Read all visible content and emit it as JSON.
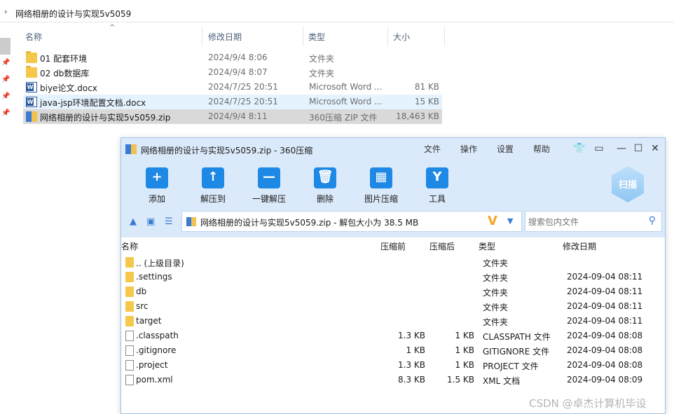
{
  "explorer": {
    "breadcrumb": "网络相册的设计与实现5v5059",
    "columns": {
      "name": "名称",
      "date": "修改日期",
      "type": "类型",
      "size": "大小"
    },
    "files": [
      {
        "name": "01 配套环境",
        "date": "2024/9/4 8:06",
        "type": "文件夹",
        "size": "",
        "icon": "folder-icon"
      },
      {
        "name": "02 db数据库",
        "date": "2024/9/4 8:07",
        "type": "文件夹",
        "size": "",
        "icon": "folder-icon"
      },
      {
        "name": "biye论文.docx",
        "date": "2024/7/25 20:51",
        "type": "Microsoft Word ...",
        "size": "81 KB",
        "icon": "word-doc-icon"
      },
      {
        "name": "java-jsp环境配置文档.docx",
        "date": "2024/7/25 20:51",
        "type": "Microsoft Word ...",
        "size": "15 KB",
        "icon": "word-doc-icon"
      },
      {
        "name": "网络相册的设计与实现5v5059.zip",
        "date": "2024/9/4 8:11",
        "type": "360压缩 ZIP 文件",
        "size": "18,463 KB",
        "icon": "zip-archive-icon"
      }
    ]
  },
  "archive_window": {
    "title": "网络相册的设计与实现5v5059.zip - 360压缩",
    "menu": [
      "文件",
      "操作",
      "设置",
      "帮助"
    ],
    "tools": [
      {
        "label": "添加",
        "icon": "add-icon",
        "glyph": "+"
      },
      {
        "label": "解压到",
        "icon": "extract-to-icon",
        "glyph": "↑"
      },
      {
        "label": "一键解压",
        "icon": "one-click-extract-icon",
        "glyph": "—"
      },
      {
        "label": "删除",
        "icon": "delete-icon",
        "glyph": "🗑"
      },
      {
        "label": "图片压缩",
        "icon": "image-compress-icon",
        "glyph": "▦"
      },
      {
        "label": "工具",
        "icon": "tools-icon",
        "glyph": "Y"
      }
    ],
    "scan_label": "扫描",
    "path_text": "网络相册的设计与实现5v5059.zip - 解包大小为 38.5 MB",
    "search_placeholder": "搜索包内文件",
    "columns": {
      "name": "名称",
      "compressed_before": "压缩前",
      "compressed_after": "压缩后",
      "type": "类型",
      "modified": "修改日期"
    },
    "entries": [
      {
        "name": ".. (上级目录)",
        "before": "",
        "after": "",
        "type": "文件夹",
        "date": "",
        "kind": "folder"
      },
      {
        "name": ".settings",
        "before": "",
        "after": "",
        "type": "文件夹",
        "date": "2024-09-04 08:11",
        "kind": "folder"
      },
      {
        "name": "db",
        "before": "",
        "after": "",
        "type": "文件夹",
        "date": "2024-09-04 08:11",
        "kind": "folder"
      },
      {
        "name": "src",
        "before": "",
        "after": "",
        "type": "文件夹",
        "date": "2024-09-04 08:11",
        "kind": "folder"
      },
      {
        "name": "target",
        "before": "",
        "after": "",
        "type": "文件夹",
        "date": "2024-09-04 08:11",
        "kind": "folder"
      },
      {
        "name": ".classpath",
        "before": "1.3 KB",
        "after": "1 KB",
        "type": "CLASSPATH 文件",
        "date": "2024-09-04 08:08",
        "kind": "file"
      },
      {
        "name": ".gitignore",
        "before": "1 KB",
        "after": "1 KB",
        "type": "GITIGNORE 文件",
        "date": "2024-09-04 08:08",
        "kind": "file"
      },
      {
        "name": ".project",
        "before": "1.3 KB",
        "after": "1 KB",
        "type": "PROJECT 文件",
        "date": "2024-09-04 08:08",
        "kind": "file"
      },
      {
        "name": "pom.xml",
        "before": "8.3 KB",
        "after": "1.5 KB",
        "type": "XML 文档",
        "date": "2024-09-04 08:09",
        "kind": "file"
      }
    ]
  },
  "watermark": "CSDN @卓杰计算机毕设",
  "colors": {
    "toolbar_bg": "#dbeafb",
    "tool_icon": "#1e88e5",
    "folder": "#f5c84c",
    "accent_v": "#f5a623"
  }
}
